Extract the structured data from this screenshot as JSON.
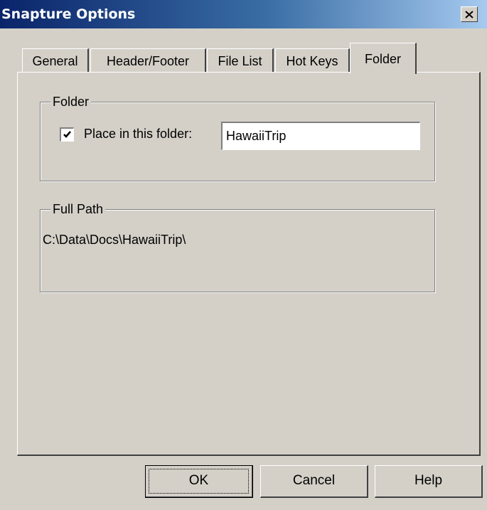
{
  "window": {
    "title": "Snapture Options",
    "close_icon": "close-icon"
  },
  "tabs": [
    {
      "label": "General",
      "active": false
    },
    {
      "label": "Header/Footer",
      "active": false
    },
    {
      "label": "File List",
      "active": false
    },
    {
      "label": "Hot Keys",
      "active": false
    },
    {
      "label": "Folder",
      "active": true
    }
  ],
  "folder_group": {
    "legend": "Folder",
    "place_in_folder": {
      "label": "Place in this folder:",
      "checked": true
    },
    "folder_input": {
      "value": "HawaiiTrip"
    }
  },
  "full_path_group": {
    "legend": "Full Path",
    "path": "C:\\Data\\Docs\\HawaiiTrip\\"
  },
  "buttons": {
    "ok": "OK",
    "cancel": "Cancel",
    "help": "Help"
  },
  "colors": {
    "face": "#d4d0c8",
    "title_start": "#0a246a",
    "title_end": "#a6caf0"
  }
}
